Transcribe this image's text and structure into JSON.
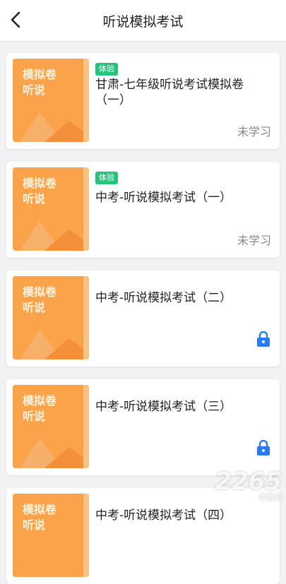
{
  "header": {
    "title": "听说模拟考试"
  },
  "cover_label": [
    "模拟卷",
    "听说"
  ],
  "items": [
    {
      "tag": "体验",
      "name": "甘肃-七年级听说考试模拟卷（一）",
      "status": "未学习"
    },
    {
      "tag": "体验",
      "name": "中考-听说模拟考试（一）",
      "status": "未学习"
    },
    {
      "tag": "",
      "name": "中考-听说模拟考试（二）",
      "status": "",
      "locked": true
    },
    {
      "tag": "",
      "name": "中考-听说模拟考试（三）",
      "status": "",
      "locked": true
    },
    {
      "tag": "",
      "name": "中考-听说模拟考试（四）",
      "status": "",
      "locked": true
    }
  ],
  "watermark": {
    "main": "2265",
    "sub": "手游网"
  },
  "colors": {
    "tag_green": "#29c17b",
    "cover_orange": "#fba34a",
    "lock_blue": "#2a7bf0"
  }
}
